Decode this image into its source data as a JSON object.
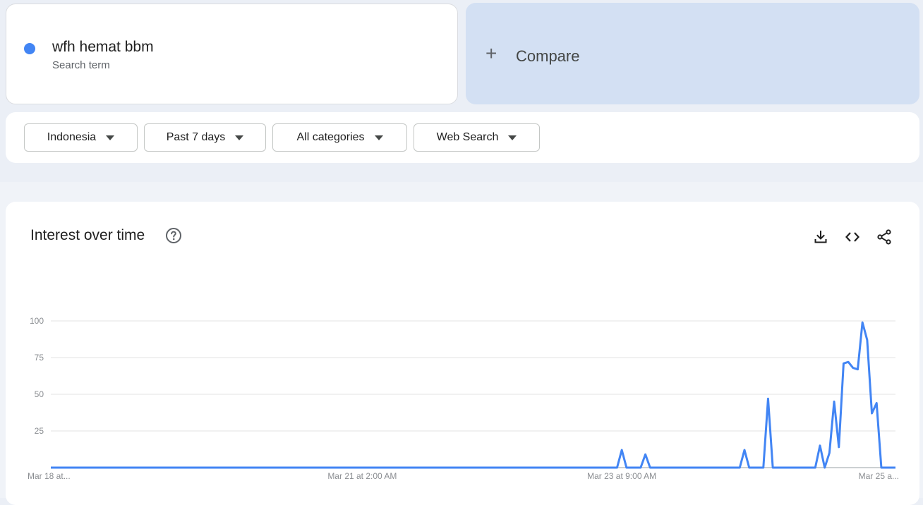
{
  "search_term": {
    "name": "wfh hemat bbm",
    "type_label": "Search term",
    "color": "#4285f4"
  },
  "compare": {
    "plus": "+",
    "label": "Compare"
  },
  "filters": {
    "region": "Indonesia",
    "time_range": "Past 7 days",
    "category": "All categories",
    "search_type": "Web Search"
  },
  "chart": {
    "title": "Interest over time",
    "help_icon": "help-circle-icon",
    "tools": [
      "download-icon",
      "embed-code-icon",
      "share-icon"
    ]
  },
  "chart_data": {
    "type": "line",
    "title": "Interest over time",
    "xlabel": "",
    "ylabel": "",
    "ylim": [
      0,
      100
    ],
    "yticks": [
      25,
      50,
      75,
      100
    ],
    "grid": true,
    "color": "#4285f4",
    "x_tick_labels": [
      {
        "label": "Mar 18 at...",
        "index": 0
      },
      {
        "label": "Mar 21 at 2:00 AM",
        "index": 66
      },
      {
        "label": "Mar 23 at 9:00 AM",
        "index": 121
      },
      {
        "label": "Mar 25 a...",
        "index": 169
      }
    ],
    "point_count": 180,
    "series": [
      {
        "name": "wfh hemat bbm",
        "nonzero_points": [
          {
            "index": 121,
            "value": 12
          },
          {
            "index": 126,
            "value": 9
          },
          {
            "index": 147,
            "value": 12
          },
          {
            "index": 152,
            "value": 47
          },
          {
            "index": 163,
            "value": 15
          },
          {
            "index": 165,
            "value": 10
          },
          {
            "index": 166,
            "value": 45
          },
          {
            "index": 167,
            "value": 14
          },
          {
            "index": 168,
            "value": 71
          },
          {
            "index": 169,
            "value": 72
          },
          {
            "index": 170,
            "value": 68
          },
          {
            "index": 171,
            "value": 67
          },
          {
            "index": 172,
            "value": 99
          },
          {
            "index": 173,
            "value": 87
          },
          {
            "index": 174,
            "value": 37
          },
          {
            "index": 175,
            "value": 44
          }
        ]
      }
    ]
  }
}
